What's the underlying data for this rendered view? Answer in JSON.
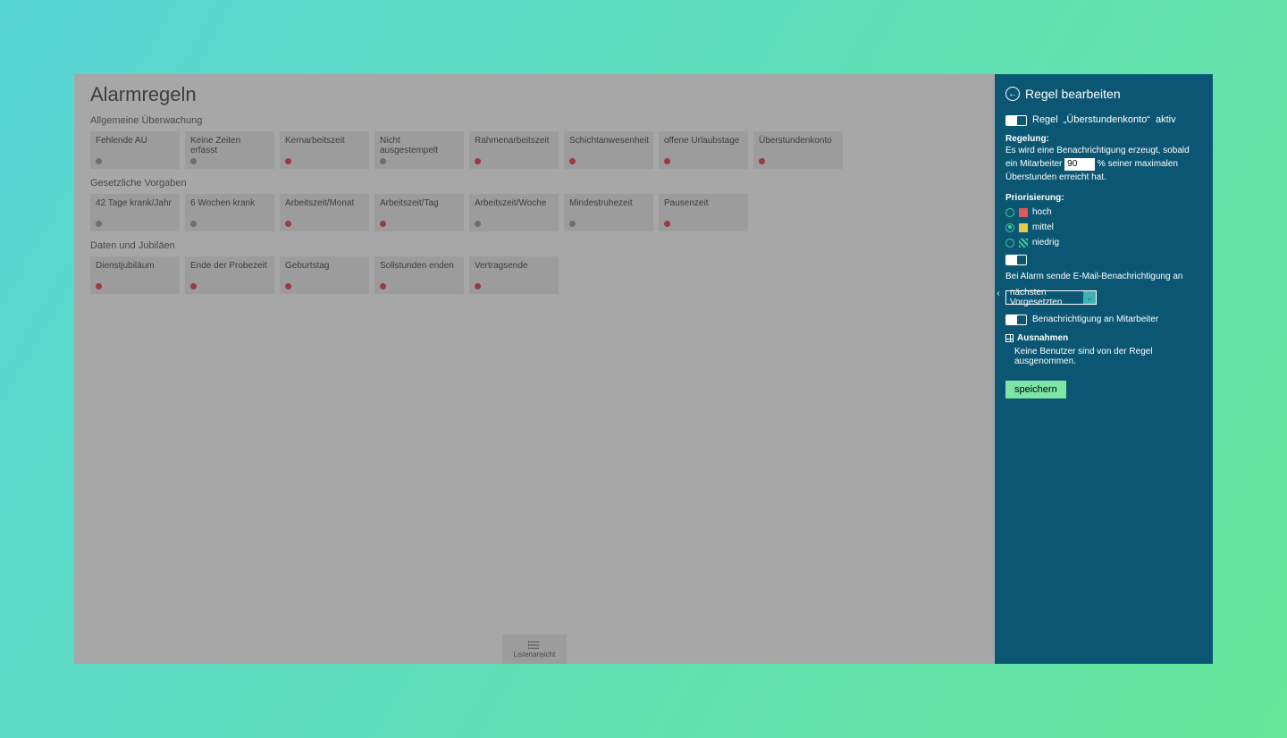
{
  "page_title": "Alarmregeln",
  "sections": [
    {
      "label": "Allgemeine Überwachung",
      "cards": [
        {
          "title": "Fehlende AU",
          "dot": "gray"
        },
        {
          "title": "Keine Zeiten erfasst",
          "dot": "gray"
        },
        {
          "title": "Kernarbeitszeit",
          "dot": "red"
        },
        {
          "title": "Nicht ausgestempelt",
          "dot": "gray"
        },
        {
          "title": "Rahmenarbeitszeit",
          "dot": "red"
        },
        {
          "title": "Schichtanwesenheit",
          "dot": "red"
        },
        {
          "title": "offene Urlaubstage",
          "dot": "red"
        },
        {
          "title": "Überstundenkonto",
          "dot": "red"
        }
      ]
    },
    {
      "label": "Gesetzliche Vorgaben",
      "cards": [
        {
          "title": "42 Tage krank/Jahr",
          "dot": "gray"
        },
        {
          "title": "6 Wochen krank",
          "dot": "gray"
        },
        {
          "title": "Arbeitszeit/Monat",
          "dot": "red"
        },
        {
          "title": "Arbeitszeit/Tag",
          "dot": "red"
        },
        {
          "title": "Arbeitszeit/Woche",
          "dot": "gray"
        },
        {
          "title": "Mindestruhezeit",
          "dot": "gray"
        },
        {
          "title": "Pausenzeit",
          "dot": "red"
        }
      ]
    },
    {
      "label": "Daten und Jubiläen",
      "cards": [
        {
          "title": "Dienstjubiläum",
          "dot": "red"
        },
        {
          "title": "Ende der Probezeit",
          "dot": "red"
        },
        {
          "title": "Geburtstag",
          "dot": "red"
        },
        {
          "title": "Sollstunden enden",
          "dot": "red"
        },
        {
          "title": "Vertragsende",
          "dot": "red"
        }
      ]
    }
  ],
  "list_view_label": "Listenansicht",
  "panel": {
    "title": "Regel bearbeiten",
    "active_row": {
      "pre": "Regel",
      "name": "„Überstundenkonto“",
      "post": "aktiv"
    },
    "regelung_label": "Regelung:",
    "regelung_text_pre": "Es wird eine Benachrichtigung erzeugt, sobald ein Mitarbeiter",
    "regelung_value": "90",
    "regelung_text_post": "% seiner maximalen Überstunden erreicht hat.",
    "prio_label": "Priorisierung:",
    "prio": [
      {
        "label": "hoch",
        "color": "red",
        "checked": false
      },
      {
        "label": "mittel",
        "color": "yellow",
        "checked": true
      },
      {
        "label": "niedrig",
        "color": "green",
        "checked": false
      }
    ],
    "email_label": "Bei Alarm sende E-Mail-Benachrichtigung an",
    "select_value": "nächsten Vorgesetzten",
    "notify_employee_label": "Benachrichtigung an Mitarbeiter",
    "exceptions_label": "Ausnahmen",
    "exceptions_text": "Keine Benutzer sind von der Regel ausgenommen.",
    "save_label": "speichern"
  }
}
